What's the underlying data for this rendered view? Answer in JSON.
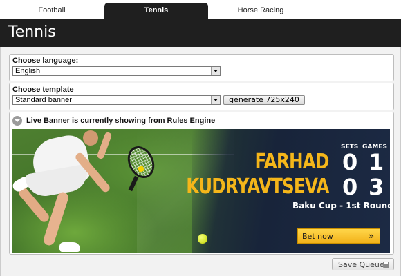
{
  "tabs": [
    {
      "label": "Football",
      "active": false
    },
    {
      "label": "Tennis",
      "active": true
    },
    {
      "label": "Horse Racing",
      "active": false
    }
  ],
  "header": {
    "title": "Tennis"
  },
  "language": {
    "label": "Choose language:",
    "selected": "English"
  },
  "template": {
    "label": "Choose template",
    "selected": "Standard banner",
    "generate_label": "generate 725x240"
  },
  "live": {
    "status_text": "Live Banner is currently showing from Rules Engine",
    "banner": {
      "sets_label": "SETS",
      "games_label": "GAMES",
      "players": [
        {
          "name": "FARHAD",
          "sets": "0",
          "games": "1"
        },
        {
          "name": "KUDRYAVTSEVA",
          "sets": "0",
          "games": "3"
        }
      ],
      "event": "Baku Cup - 1st Round",
      "bet_label": "Bet now",
      "bet_chevron": "»"
    }
  },
  "actions": {
    "save_queue_label": "Save Queue"
  },
  "colors": {
    "header_bg": "#1f1f1f",
    "player_name": "#f5b61a",
    "bet_button": "#f2b21a"
  }
}
